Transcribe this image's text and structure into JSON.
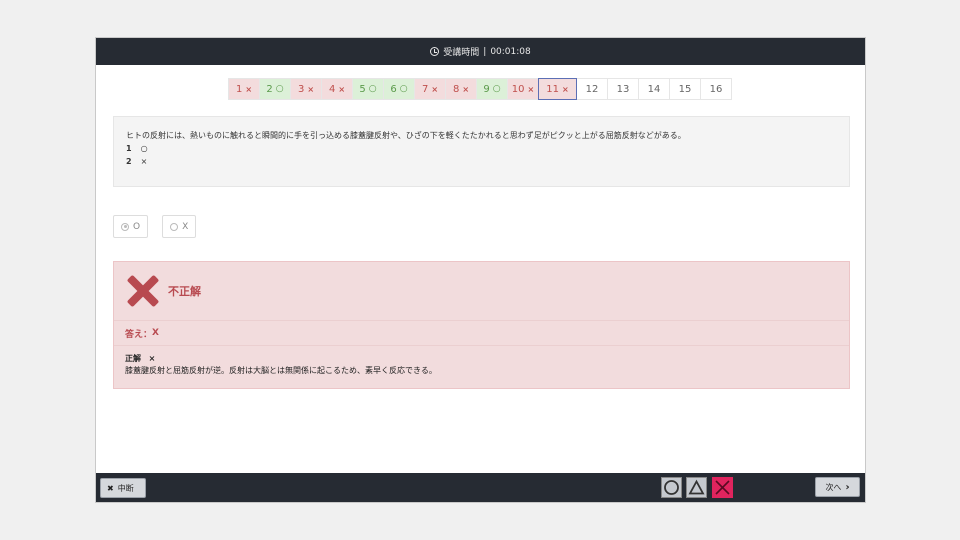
{
  "header": {
    "label": "受講時間",
    "separator": "|",
    "time": "00:01:08"
  },
  "question_nav": [
    {
      "num": "1",
      "mark": "×",
      "state": "wrong"
    },
    {
      "num": "2",
      "mark": "○",
      "state": "correct"
    },
    {
      "num": "3",
      "mark": "×",
      "state": "wrong"
    },
    {
      "num": "4",
      "mark": "×",
      "state": "wrong"
    },
    {
      "num": "5",
      "mark": "○",
      "state": "correct"
    },
    {
      "num": "6",
      "mark": "○",
      "state": "correct"
    },
    {
      "num": "7",
      "mark": "×",
      "state": "wrong"
    },
    {
      "num": "8",
      "mark": "×",
      "state": "wrong"
    },
    {
      "num": "9",
      "mark": "○",
      "state": "correct"
    },
    {
      "num": "10",
      "mark": "×",
      "state": "wrong"
    },
    {
      "num": "11",
      "mark": "×",
      "state": "current"
    },
    {
      "num": "12",
      "mark": "",
      "state": "plain"
    },
    {
      "num": "13",
      "mark": "",
      "state": "plain"
    },
    {
      "num": "14",
      "mark": "",
      "state": "plain"
    },
    {
      "num": "15",
      "mark": "",
      "state": "plain"
    },
    {
      "num": "16",
      "mark": "",
      "state": "plain"
    }
  ],
  "question": {
    "text": "ヒトの反射には、熱いものに触れると瞬間的に手を引っ込める膝蓋腱反射や、ひざの下を軽くたたかれると思わず足がピクッと上がる屈筋反射などがある。",
    "options": [
      {
        "num": "1",
        "label": "○"
      },
      {
        "num": "2",
        "label": "×"
      }
    ]
  },
  "answers": [
    {
      "label": "O",
      "selected": true
    },
    {
      "label": "X",
      "selected": false
    }
  ],
  "result": {
    "status": "不正解",
    "answer_label": "答え：",
    "answer_value": "X",
    "explanation_title": "正解",
    "explanation_mark": "×",
    "explanation_text": "膝蓋腱反射と屈筋反射が逆。反射は大脳とは無関係に起こるため、素早く反応できる。"
  },
  "footer": {
    "suspend_label": "中断",
    "next_label": "次へ"
  },
  "colors": {
    "wrong_bg": "#f3dcdd",
    "correct_bg": "#dcf0d8",
    "accent_red": "#b84a50",
    "cross_button": "#e0245e",
    "bar": "#262b33"
  }
}
